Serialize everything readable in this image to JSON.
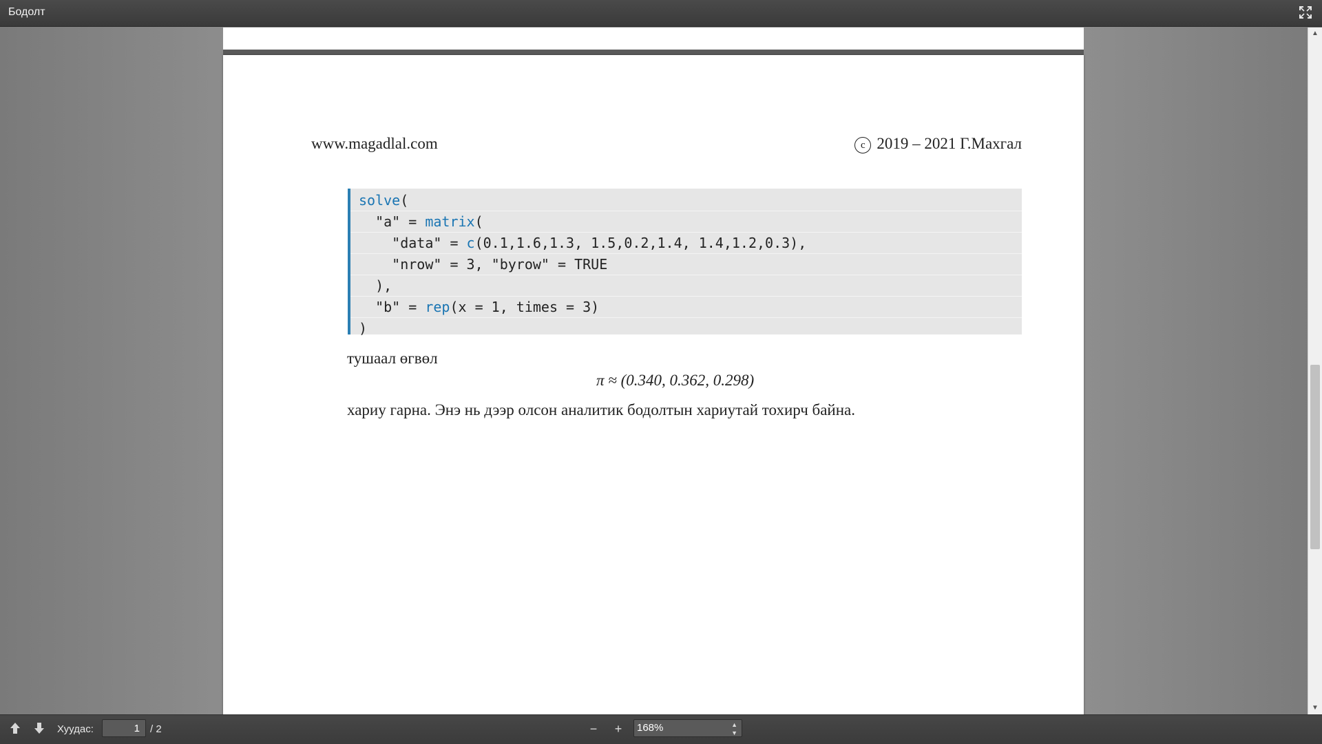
{
  "titlebar": {
    "title": "Бодолт",
    "fullscreen_icon": "fullscreen-icon"
  },
  "page": {
    "header_left": "www.magadlal.com",
    "copyright_symbol": "c",
    "header_right": "2019 – 2021 Г.Махгал",
    "code": {
      "line1_fn": "solve",
      "line1_rest": "(",
      "line2_pre": "  \"a\" = ",
      "line2_fn": "matrix",
      "line2_rest": "(",
      "line3_pre": "    \"data\" = ",
      "line3_fn": "c",
      "line3_rest": "(0.1,1.6,1.3, 1.5,0.2,1.4, 1.4,1.2,0.3),",
      "line4": "    \"nrow\" = 3, \"byrow\" = TRUE",
      "line5": "  ),",
      "line6_pre": "  \"b\" = ",
      "line6_fn": "rep",
      "line6_rest": "(x = 1, times = 3)",
      "line7": ")"
    },
    "text1": "тушаал өгвөл",
    "formula": "π ≈ (0.340, 0.362, 0.298)",
    "text2": "хариу гарна. Энэ нь дээр олсон аналитик бодолтын хариутай тохирч байна."
  },
  "scrollbar": {
    "up_arrow": "▲",
    "down_arrow": "▼"
  },
  "toolbar": {
    "prev_icon": "arrow-up-icon",
    "next_icon": "arrow-down-icon",
    "page_label": "Хуудас:",
    "page_value": "1",
    "page_total": "/ 2",
    "zoom_out_label": "−",
    "zoom_in_label": "+",
    "zoom_value": "168%"
  }
}
